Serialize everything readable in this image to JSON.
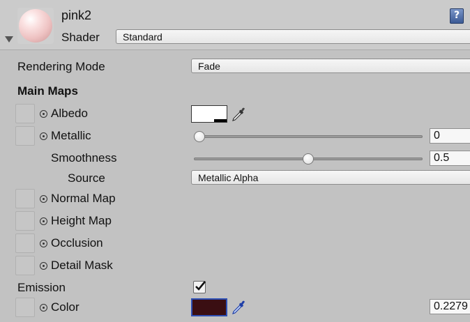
{
  "header": {
    "material_name": "pink2",
    "shader_label": "Shader",
    "shader_value": "Standard"
  },
  "rendering_mode": {
    "label": "Rendering Mode",
    "value": "Fade"
  },
  "main_maps": {
    "heading": "Main Maps",
    "albedo": {
      "label": "Albedo",
      "color": "#ffffff"
    },
    "metallic": {
      "label": "Metallic",
      "value": "0",
      "slider_fraction": 0.0
    },
    "smoothness": {
      "label": "Smoothness",
      "value": "0.5",
      "slider_fraction": 0.5
    },
    "source": {
      "label": "Source",
      "value": "Metallic Alpha"
    },
    "normal_map": {
      "label": "Normal Map"
    },
    "height_map": {
      "label": "Height Map"
    },
    "occlusion": {
      "label": "Occlusion"
    },
    "detail_mask": {
      "label": "Detail Mask"
    }
  },
  "emission": {
    "label": "Emission",
    "enabled": true,
    "color_label": "Color",
    "color": "#3a0e12",
    "intensity": "0.2279"
  }
}
